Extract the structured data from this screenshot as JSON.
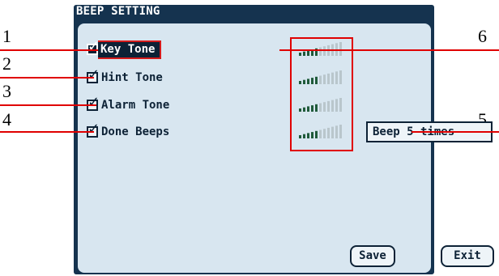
{
  "window": {
    "title": "BEEP SETTING"
  },
  "rows": [
    {
      "label": "Key Tone",
      "checked": true,
      "selected": true,
      "volume_level": 5,
      "volume_max": 11
    },
    {
      "label": "Hint Tone",
      "checked": true,
      "selected": false,
      "volume_level": 5,
      "volume_max": 11
    },
    {
      "label": "Alarm Tone",
      "checked": true,
      "selected": false,
      "volume_level": 5,
      "volume_max": 11
    },
    {
      "label": "Done Beeps",
      "checked": true,
      "selected": false,
      "volume_level": 5,
      "volume_max": 11
    }
  ],
  "done_beeps_field": {
    "value": "Beep 5 times"
  },
  "buttons": {
    "save": "Save",
    "exit": "Exit"
  },
  "callouts": {
    "c1": "1",
    "c2": "2",
    "c3": "3",
    "c4": "4",
    "c5": "5",
    "c6": "6"
  },
  "colors": {
    "screen_bg": "#15334f",
    "panel_bg": "#d8e6f0",
    "ink": "#0d2236",
    "volume_on": "#1f5a3a",
    "volume_off": "#b9c6cc",
    "callout_red": "#e00000"
  }
}
